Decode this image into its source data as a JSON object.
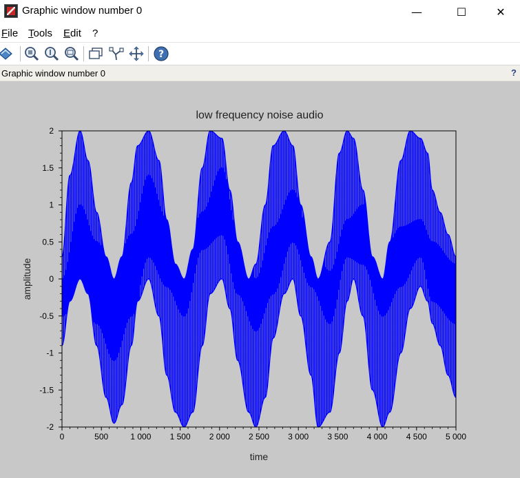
{
  "window": {
    "title": "Graphic window number 0",
    "controls": {
      "minimize": "—",
      "maximize": "☐",
      "close": "✕"
    }
  },
  "menu": {
    "items": [
      {
        "label": "File"
      },
      {
        "label": "Tools"
      },
      {
        "label": "Edit"
      },
      {
        "label": "?"
      }
    ]
  },
  "toolbar": {
    "buttons": [
      {
        "icon": "rotate-icon"
      },
      {
        "icon": "zoom-in-icon"
      },
      {
        "icon": "zoom-reset-icon"
      },
      {
        "icon": "zoom-area-icon"
      },
      {
        "icon": "select-figure-icon"
      },
      {
        "icon": "datatip-icon"
      },
      {
        "icon": "pan-icon"
      },
      {
        "icon": "help-icon"
      }
    ]
  },
  "infobar": {
    "label": "Graphic window number 0",
    "help": "?"
  },
  "colors": {
    "signal": "#0000ff",
    "figure_background": "#c8c8c8",
    "axes_background": "#c8c8c8"
  },
  "chart_data": {
    "type": "line",
    "title": "low frequency noise audio",
    "xlabel": "time",
    "ylabel": "amplitude",
    "xlim": [
      0,
      5000
    ],
    "ylim": [
      -2,
      2
    ],
    "xticks": [
      0,
      500,
      1000,
      1500,
      2000,
      2500,
      3000,
      3500,
      4000,
      4500,
      5000
    ],
    "xtick_labels": [
      "0",
      "500",
      "1 000",
      "1 500",
      "2 000",
      "2 500",
      "3 000",
      "3 500",
      "4 000",
      "4 500",
      "5 000"
    ],
    "yticks": [
      -2,
      -1.5,
      -1,
      -0.5,
      0,
      0.5,
      1,
      1.5,
      2
    ],
    "ytick_labels": [
      "-2",
      "-1.5",
      "-1",
      "-0.5",
      "0",
      "0.5",
      "1",
      "1.5",
      "2"
    ],
    "grid": false,
    "legend": "none",
    "series": [
      {
        "description_visible": "dense blue oscillating signal",
        "upper_envelope": {
          "x": [
            0,
            100,
            230,
            330,
            440,
            560,
            660,
            760,
            880,
            960,
            1100,
            1230,
            1330,
            1440,
            1550,
            1660,
            1780,
            1880,
            2030,
            2130,
            2230,
            2370,
            2460,
            2580,
            2680,
            2820,
            2930,
            3030,
            3160,
            3250,
            3400,
            3520,
            3620,
            3700,
            3820,
            3940,
            4070,
            4160,
            4300,
            4420,
            4550,
            4640,
            4700,
            4800,
            4900,
            5000
          ],
          "y": [
            0.3,
            1.4,
            2.0,
            1.6,
            0.9,
            0.3,
            0.0,
            0.3,
            1.3,
            1.8,
            2.0,
            1.6,
            0.8,
            0.2,
            0.0,
            0.4,
            1.5,
            2.0,
            1.9,
            1.2,
            0.5,
            0.0,
            0.2,
            1.0,
            1.8,
            2.0,
            1.8,
            1.0,
            0.3,
            0.0,
            0.5,
            1.7,
            2.0,
            1.9,
            1.2,
            0.3,
            0.0,
            0.5,
            1.6,
            2.0,
            1.9,
            1.7,
            1.2,
            0.9,
            0.6,
            0.3
          ]
        },
        "lower_envelope": {
          "x": [
            0,
            100,
            230,
            330,
            440,
            560,
            660,
            760,
            880,
            960,
            1100,
            1230,
            1330,
            1440,
            1550,
            1660,
            1780,
            1880,
            2030,
            2130,
            2230,
            2370,
            2460,
            2580,
            2680,
            2820,
            2930,
            3030,
            3160,
            3250,
            3400,
            3520,
            3620,
            3700,
            3820,
            3940,
            4070,
            4160,
            4300,
            4420,
            4550,
            4640,
            4700,
            4800,
            4900,
            5000
          ],
          "y": [
            -0.9,
            -0.3,
            0.0,
            -0.2,
            -0.9,
            -1.6,
            -1.95,
            -1.7,
            -0.9,
            -0.3,
            0.0,
            -0.5,
            -1.3,
            -1.8,
            -2.0,
            -1.8,
            -0.9,
            -0.2,
            0.0,
            -0.4,
            -1.1,
            -1.8,
            -2.0,
            -1.6,
            -0.8,
            -0.2,
            0.0,
            -0.5,
            -1.3,
            -2.0,
            -1.8,
            -1.0,
            -0.3,
            0.0,
            -0.5,
            -1.5,
            -2.0,
            -1.8,
            -1.0,
            -0.4,
            -0.1,
            -0.3,
            -0.6,
            -0.9,
            -1.3,
            -1.6
          ]
        },
        "inner_upper": {
          "x": [
            0,
            230,
            440,
            660,
            880,
            1100,
            1330,
            1550,
            1780,
            2030,
            2230,
            2460,
            2680,
            2930,
            3160,
            3400,
            3620,
            3820,
            4070,
            4300,
            4550,
            4700,
            5000
          ],
          "y": [
            0.0,
            1.0,
            0.5,
            0.1,
            0.6,
            1.4,
            0.8,
            0.2,
            0.9,
            1.5,
            0.6,
            0.0,
            0.7,
            1.2,
            0.5,
            0.1,
            0.8,
            1.0,
            0.3,
            0.7,
            0.8,
            0.5,
            0.2
          ]
        },
        "inner_lower": {
          "x": [
            0,
            230,
            440,
            660,
            880,
            1100,
            1330,
            1550,
            1780,
            2030,
            2230,
            2460,
            2680,
            2930,
            3160,
            3400,
            3620,
            3820,
            4070,
            4300,
            4550,
            4700,
            5000
          ],
          "y": [
            -0.5,
            -0.2,
            -0.6,
            -1.1,
            -0.5,
            0.3,
            -0.1,
            -0.5,
            0.4,
            0.6,
            -0.2,
            -0.7,
            -0.2,
            0.5,
            -0.1,
            -0.6,
            0.3,
            0.2,
            -0.5,
            -0.1,
            0.3,
            -0.3,
            -0.6
          ]
        }
      }
    ]
  }
}
